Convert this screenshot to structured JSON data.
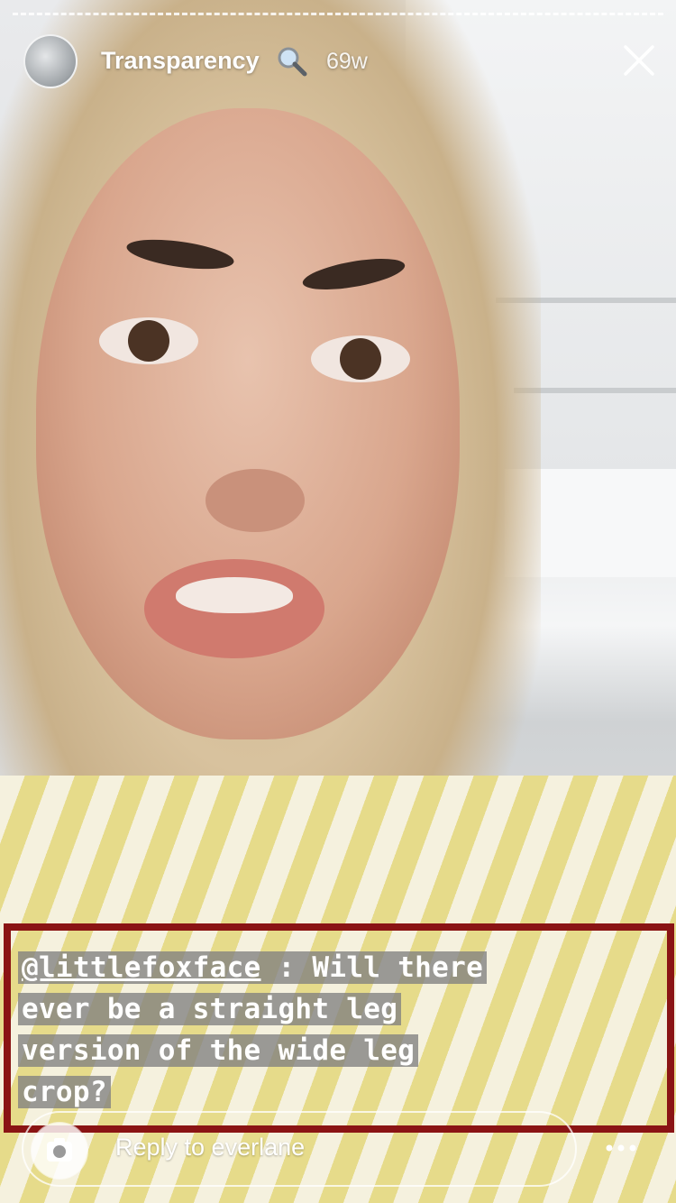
{
  "story": {
    "title": "Transparency",
    "title_icon": "magnifying-glass-icon",
    "time": "69w"
  },
  "caption": {
    "mention": "@littlefoxface",
    "line1_rest": " : Will there",
    "line2": "ever be a straight leg",
    "line3": "version of the wide leg",
    "line4": "crop?"
  },
  "reply": {
    "placeholder": "Reply to everlane"
  },
  "colors": {
    "highlight_frame": "#8a1414",
    "caption_bg": "#808080"
  }
}
